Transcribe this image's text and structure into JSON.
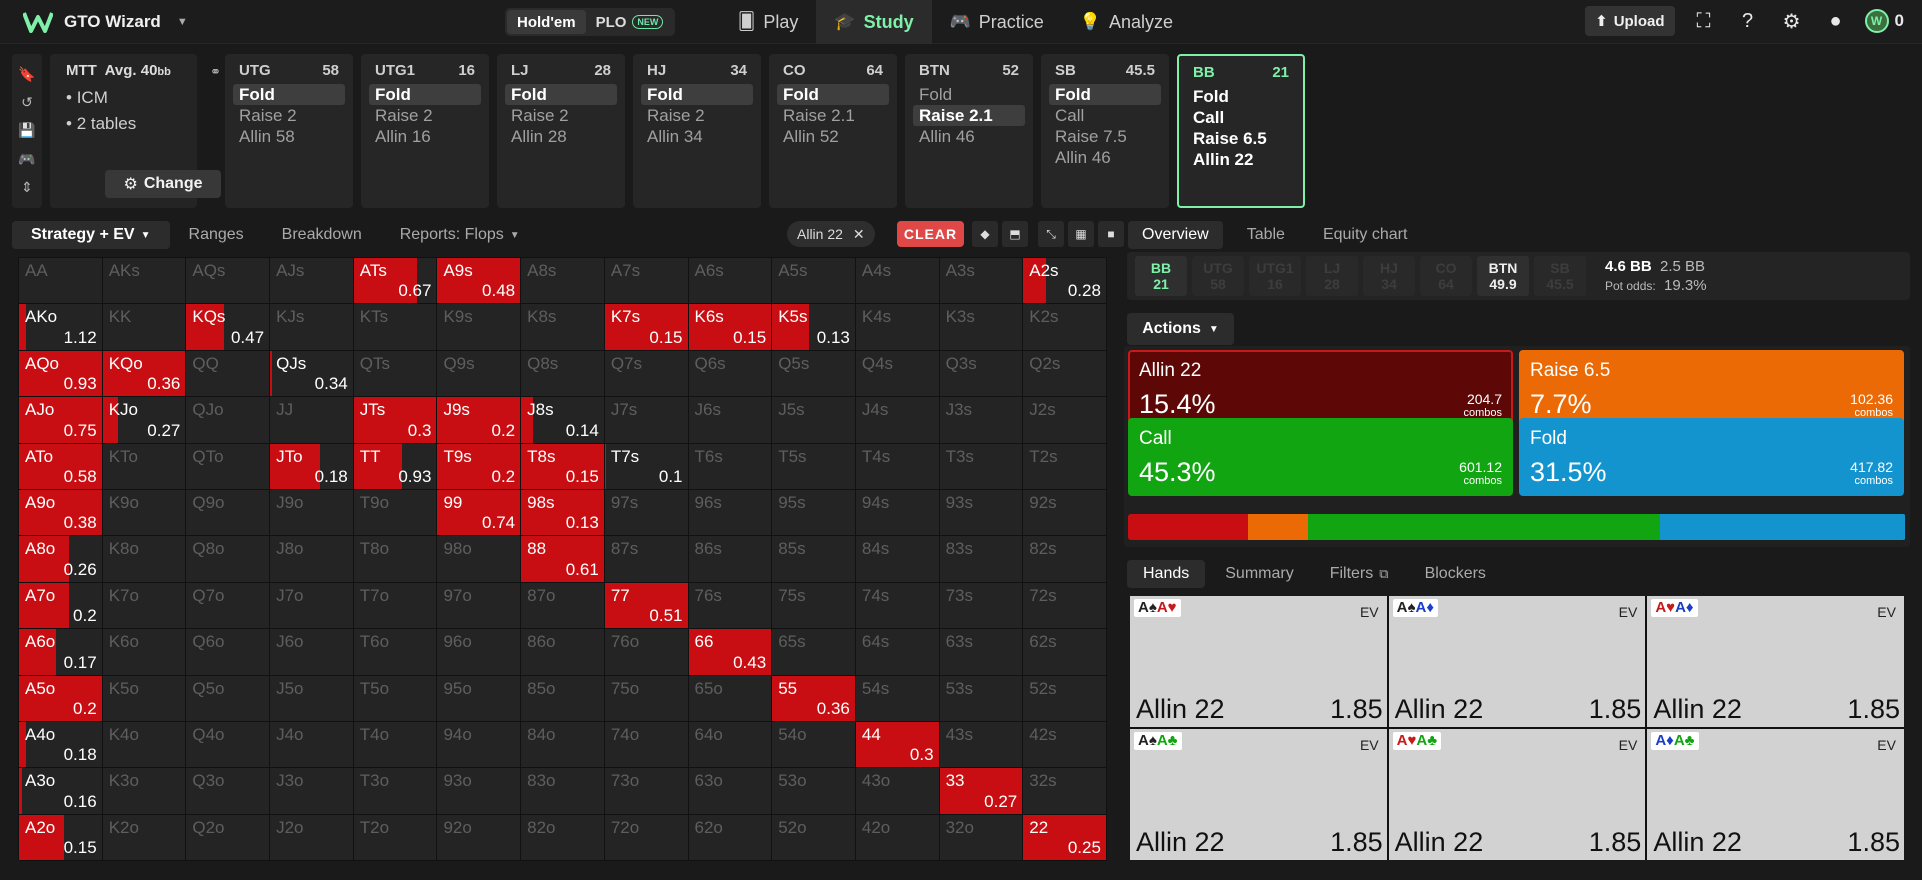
{
  "app": {
    "name": "GTO Wizard"
  },
  "game_switch": {
    "holdem": "Hold'em",
    "plo": "PLO",
    "new_badge": "NEW"
  },
  "nav": [
    {
      "label": "Play",
      "icon": "cards-icon"
    },
    {
      "label": "Study",
      "icon": "graduation-cap-icon"
    },
    {
      "label": "Practice",
      "icon": "gamepad-icon"
    },
    {
      "label": "Analyze",
      "icon": "lightbulb-icon"
    }
  ],
  "upload_label": "Upload",
  "coins": "0",
  "mtt": {
    "title": "MTT",
    "avg": "Avg. 40",
    "avg_unit": "bb",
    "bullets": [
      "ICM",
      "2 tables"
    ],
    "change": "Change"
  },
  "positions": [
    {
      "name": "UTG",
      "stack": "58",
      "actions": [
        "Fold",
        "Raise 2",
        "Allin 58"
      ],
      "selected": 0
    },
    {
      "name": "UTG1",
      "stack": "16",
      "actions": [
        "Fold",
        "Raise 2",
        "Allin 16"
      ],
      "selected": 0
    },
    {
      "name": "LJ",
      "stack": "28",
      "actions": [
        "Fold",
        "Raise 2",
        "Allin 28"
      ],
      "selected": 0
    },
    {
      "name": "HJ",
      "stack": "34",
      "actions": [
        "Fold",
        "Raise 2",
        "Allin 34"
      ],
      "selected": 0
    },
    {
      "name": "CO",
      "stack": "64",
      "actions": [
        "Fold",
        "Raise 2.1",
        "Allin 52"
      ],
      "selected": 0
    },
    {
      "name": "BTN",
      "stack": "52",
      "actions": [
        "Fold",
        "Raise 2.1",
        "Allin 46"
      ],
      "selected": 1
    },
    {
      "name": "SB",
      "stack": "45.5",
      "actions": [
        "Fold",
        "Call",
        "Raise 7.5",
        "Allin 46"
      ],
      "selected": 0
    },
    {
      "name": "BB",
      "stack": "21",
      "actions": [
        "Fold",
        "Call",
        "Raise 6.5",
        "Allin 22"
      ],
      "selected": -1
    }
  ],
  "left_tabs": {
    "strategy": "Strategy + EV",
    "ranges": "Ranges",
    "breakdown": "Breakdown",
    "reports": "Reports: Flops"
  },
  "filter_chip": "Allin 22",
  "clear": "CLEAR",
  "grid": [
    [
      "AA",
      "",
      "0"
    ],
    [
      "AKs",
      "",
      "0"
    ],
    [
      "AQs",
      "",
      "0"
    ],
    [
      "AJs",
      "",
      "0"
    ],
    [
      "ATs",
      "0.67",
      "0.76"
    ],
    [
      "A9s",
      "0.48",
      "1"
    ],
    [
      "A8s",
      "",
      "0"
    ],
    [
      "A7s",
      "",
      "0"
    ],
    [
      "A6s",
      "",
      "0"
    ],
    [
      "A5s",
      "",
      "0"
    ],
    [
      "A4s",
      "",
      "0"
    ],
    [
      "A3s",
      "",
      "0"
    ],
    [
      "A2s",
      "0.28",
      "0.28"
    ],
    [
      "AKo",
      "1.12",
      "0.08"
    ],
    [
      "KK",
      "",
      "0"
    ],
    [
      "KQs",
      "0.47",
      "0.45"
    ],
    [
      "KJs",
      "",
      "0"
    ],
    [
      "KTs",
      "",
      "0"
    ],
    [
      "K9s",
      "",
      "0"
    ],
    [
      "K8s",
      "",
      "0"
    ],
    [
      "K7s",
      "0.15",
      "1"
    ],
    [
      "K6s",
      "0.15",
      "1"
    ],
    [
      "K5s",
      "0.13",
      "0.45"
    ],
    [
      "K4s",
      "",
      "0"
    ],
    [
      "K3s",
      "",
      "0"
    ],
    [
      "K2s",
      "",
      "0"
    ],
    [
      "AQo",
      "0.93",
      "1"
    ],
    [
      "KQo",
      "0.36",
      "1"
    ],
    [
      "QQ",
      "",
      "0"
    ],
    [
      "QJs",
      "0.34",
      "0.02"
    ],
    [
      "QTs",
      "",
      "0"
    ],
    [
      "Q9s",
      "",
      "0"
    ],
    [
      "Q8s",
      "",
      "0"
    ],
    [
      "Q7s",
      "",
      "0"
    ],
    [
      "Q6s",
      "",
      "0"
    ],
    [
      "Q5s",
      "",
      "0"
    ],
    [
      "Q4s",
      "",
      "0"
    ],
    [
      "Q3s",
      "",
      "0"
    ],
    [
      "Q2s",
      "",
      "0"
    ],
    [
      "AJo",
      "0.75",
      "1"
    ],
    [
      "KJo",
      "0.27",
      "0.18"
    ],
    [
      "QJo",
      "",
      "0"
    ],
    [
      "JJ",
      "",
      "0"
    ],
    [
      "JTs",
      "0.3",
      "1"
    ],
    [
      "J9s",
      "0.2",
      "1"
    ],
    [
      "J8s",
      "0.14",
      "0.14"
    ],
    [
      "J7s",
      "",
      "0"
    ],
    [
      "J6s",
      "",
      "0"
    ],
    [
      "J5s",
      "",
      "0"
    ],
    [
      "J4s",
      "",
      "0"
    ],
    [
      "J3s",
      "",
      "0"
    ],
    [
      "J2s",
      "",
      "0"
    ],
    [
      "ATo",
      "0.58",
      "1"
    ],
    [
      "KTo",
      "",
      "0"
    ],
    [
      "QTo",
      "",
      "0"
    ],
    [
      "JTo",
      "0.18",
      "0.6"
    ],
    [
      "TT",
      "0.93",
      "0.58"
    ],
    [
      "T9s",
      "0.2",
      "1"
    ],
    [
      "T8s",
      "0.15",
      "1"
    ],
    [
      "T7s",
      "0.1",
      "0.02"
    ],
    [
      "T6s",
      "",
      "0"
    ],
    [
      "T5s",
      "",
      "0"
    ],
    [
      "T4s",
      "",
      "0"
    ],
    [
      "T3s",
      "",
      "0"
    ],
    [
      "T2s",
      "",
      "0"
    ],
    [
      "A9o",
      "0.38",
      "1"
    ],
    [
      "K9o",
      "",
      "0"
    ],
    [
      "Q9o",
      "",
      "0"
    ],
    [
      "J9o",
      "",
      "0"
    ],
    [
      "T9o",
      "",
      "0"
    ],
    [
      "99",
      "0.74",
      "1"
    ],
    [
      "98s",
      "0.13",
      "1"
    ],
    [
      "97s",
      "",
      "0"
    ],
    [
      "96s",
      "",
      "0"
    ],
    [
      "95s",
      "",
      "0"
    ],
    [
      "94s",
      "",
      "0"
    ],
    [
      "93s",
      "",
      "0"
    ],
    [
      "92s",
      "",
      "0"
    ],
    [
      "A8o",
      "0.26",
      "0.6"
    ],
    [
      "K8o",
      "",
      "0"
    ],
    [
      "Q8o",
      "",
      "0"
    ],
    [
      "J8o",
      "",
      "0"
    ],
    [
      "T8o",
      "",
      "0"
    ],
    [
      "98o",
      "",
      "0"
    ],
    [
      "88",
      "0.61",
      "1"
    ],
    [
      "87s",
      "",
      "0"
    ],
    [
      "86s",
      "",
      "0"
    ],
    [
      "85s",
      "",
      "0"
    ],
    [
      "84s",
      "",
      "0"
    ],
    [
      "83s",
      "",
      "0"
    ],
    [
      "82s",
      "",
      "0"
    ],
    [
      "A7o",
      "0.2",
      "0.6"
    ],
    [
      "K7o",
      "",
      "0"
    ],
    [
      "Q7o",
      "",
      "0"
    ],
    [
      "J7o",
      "",
      "0"
    ],
    [
      "T7o",
      "",
      "0"
    ],
    [
      "97o",
      "",
      "0"
    ],
    [
      "87o",
      "",
      "0"
    ],
    [
      "77",
      "0.51",
      "1"
    ],
    [
      "76s",
      "",
      "0"
    ],
    [
      "75s",
      "",
      "0"
    ],
    [
      "74s",
      "",
      "0"
    ],
    [
      "73s",
      "",
      "0"
    ],
    [
      "72s",
      "",
      "0"
    ],
    [
      "A6o",
      "0.17",
      "0.45"
    ],
    [
      "K6o",
      "",
      "0"
    ],
    [
      "Q6o",
      "",
      "0"
    ],
    [
      "J6o",
      "",
      "0"
    ],
    [
      "T6o",
      "",
      "0"
    ],
    [
      "96o",
      "",
      "0"
    ],
    [
      "86o",
      "",
      "0"
    ],
    [
      "76o",
      "",
      "0"
    ],
    [
      "66",
      "0.43",
      "1"
    ],
    [
      "65s",
      "",
      "0"
    ],
    [
      "64s",
      "",
      "0"
    ],
    [
      "63s",
      "",
      "0"
    ],
    [
      "62s",
      "",
      "0"
    ],
    [
      "A5o",
      "0.2",
      "1"
    ],
    [
      "K5o",
      "",
      "0"
    ],
    [
      "Q5o",
      "",
      "0"
    ],
    [
      "J5o",
      "",
      "0"
    ],
    [
      "T5o",
      "",
      "0"
    ],
    [
      "95o",
      "",
      "0"
    ],
    [
      "85o",
      "",
      "0"
    ],
    [
      "75o",
      "",
      "0"
    ],
    [
      "65o",
      "",
      "0"
    ],
    [
      "55",
      "0.36",
      "1"
    ],
    [
      "54s",
      "",
      "0"
    ],
    [
      "53s",
      "",
      "0"
    ],
    [
      "52s",
      "",
      "0"
    ],
    [
      "A4o",
      "0.18",
      "0.08"
    ],
    [
      "K4o",
      "",
      "0"
    ],
    [
      "Q4o",
      "",
      "0"
    ],
    [
      "J4o",
      "",
      "0"
    ],
    [
      "T4o",
      "",
      "0"
    ],
    [
      "94o",
      "",
      "0"
    ],
    [
      "84o",
      "",
      "0"
    ],
    [
      "74o",
      "",
      "0"
    ],
    [
      "64o",
      "",
      "0"
    ],
    [
      "54o",
      "",
      "0"
    ],
    [
      "44",
      "0.3",
      "1"
    ],
    [
      "43s",
      "",
      "0"
    ],
    [
      "42s",
      "",
      "0"
    ],
    [
      "A3o",
      "0.16",
      "0.04"
    ],
    [
      "K3o",
      "",
      "0"
    ],
    [
      "Q3o",
      "",
      "0"
    ],
    [
      "J3o",
      "",
      "0"
    ],
    [
      "T3o",
      "",
      "0"
    ],
    [
      "93o",
      "",
      "0"
    ],
    [
      "83o",
      "",
      "0"
    ],
    [
      "73o",
      "",
      "0"
    ],
    [
      "63o",
      "",
      "0"
    ],
    [
      "53o",
      "",
      "0"
    ],
    [
      "43o",
      "",
      "0"
    ],
    [
      "33",
      "0.27",
      "1"
    ],
    [
      "32s",
      "",
      "0"
    ],
    [
      "A2o",
      "0.15",
      "0.55"
    ],
    [
      "K2o",
      "",
      "0"
    ],
    [
      "Q2o",
      "",
      "0"
    ],
    [
      "J2o",
      "",
      "0"
    ],
    [
      "T2o",
      "",
      "0"
    ],
    [
      "92o",
      "",
      "0"
    ],
    [
      "82o",
      "",
      "0"
    ],
    [
      "72o",
      "",
      "0"
    ],
    [
      "62o",
      "",
      "0"
    ],
    [
      "52o",
      "",
      "0"
    ],
    [
      "42o",
      "",
      "0"
    ],
    [
      "32o",
      "",
      "0"
    ],
    [
      "22",
      "0.25",
      "1"
    ]
  ],
  "right_tabs": {
    "overview": "Overview",
    "table": "Table",
    "equity": "Equity chart"
  },
  "pos_chips": [
    {
      "n": "BB",
      "s": "21",
      "state": "bb"
    },
    {
      "n": "UTG",
      "s": "58",
      "state": "off"
    },
    {
      "n": "UTG1",
      "s": "16",
      "state": "off"
    },
    {
      "n": "LJ",
      "s": "28",
      "state": "off"
    },
    {
      "n": "HJ",
      "s": "34",
      "state": "off"
    },
    {
      "n": "CO",
      "s": "64",
      "state": "off"
    },
    {
      "n": "BTN",
      "s": "49.9",
      "state": "on"
    },
    {
      "n": "SB",
      "s": "45.5",
      "state": "off"
    }
  ],
  "pot": {
    "bb": "4.6 BB",
    "alt": "2.5 BB",
    "odds_label": "Pot odds:",
    "odds": "19.3%"
  },
  "actions_dd": "Actions",
  "actions": [
    {
      "name": "Allin 22",
      "pct": "15.4%",
      "combos": "204.7",
      "combos_label": "combos",
      "color": "#5e0707",
      "border": "#c81a1a",
      "freq": 15.4
    },
    {
      "name": "Raise 6.5",
      "pct": "7.7%",
      "combos": "102.36",
      "combos_label": "combos",
      "color": "#eb6a05",
      "border": "#eb6a05",
      "freq": 7.7
    },
    {
      "name": "Call",
      "pct": "45.3%",
      "combos": "601.12",
      "combos_label": "combos",
      "color": "#12a512",
      "border": "#12a512",
      "freq": 45.3
    },
    {
      "name": "Fold",
      "pct": "31.5%",
      "combos": "417.82",
      "combos_label": "combos",
      "color": "#1494cf",
      "border": "#1494cf",
      "freq": 31.5
    }
  ],
  "freq_colors": [
    "#c80e12",
    "#eb6a05",
    "#12a512",
    "#1494cf"
  ],
  "hand_tabs": {
    "hands": "Hands",
    "summary": "Summary",
    "filters": "Filters",
    "blockers": "Blockers"
  },
  "hands": [
    {
      "c1": "A",
      "s1": "♠",
      "c2": "A",
      "s2": "♥",
      "ev": "EV",
      "act": "Allin 22",
      "val": "1.85"
    },
    {
      "c1": "A",
      "s1": "♠",
      "c2": "A",
      "s2": "♦",
      "ev": "EV",
      "act": "Allin 22",
      "val": "1.85"
    },
    {
      "c1": "A",
      "s1": "♥",
      "c2": "A",
      "s2": "♦",
      "ev": "EV",
      "act": "Allin 22",
      "val": "1.85"
    },
    {
      "c1": "A",
      "s1": "♠",
      "c2": "A",
      "s2": "♣",
      "ev": "EV",
      "act": "Allin 22",
      "val": "1.85"
    },
    {
      "c1": "A",
      "s1": "♥",
      "c2": "A",
      "s2": "♣",
      "ev": "EV",
      "act": "Allin 22",
      "val": "1.85"
    },
    {
      "c1": "A",
      "s1": "♦",
      "c2": "A",
      "s2": "♣",
      "ev": "EV",
      "act": "Allin 22",
      "val": "1.85"
    }
  ]
}
